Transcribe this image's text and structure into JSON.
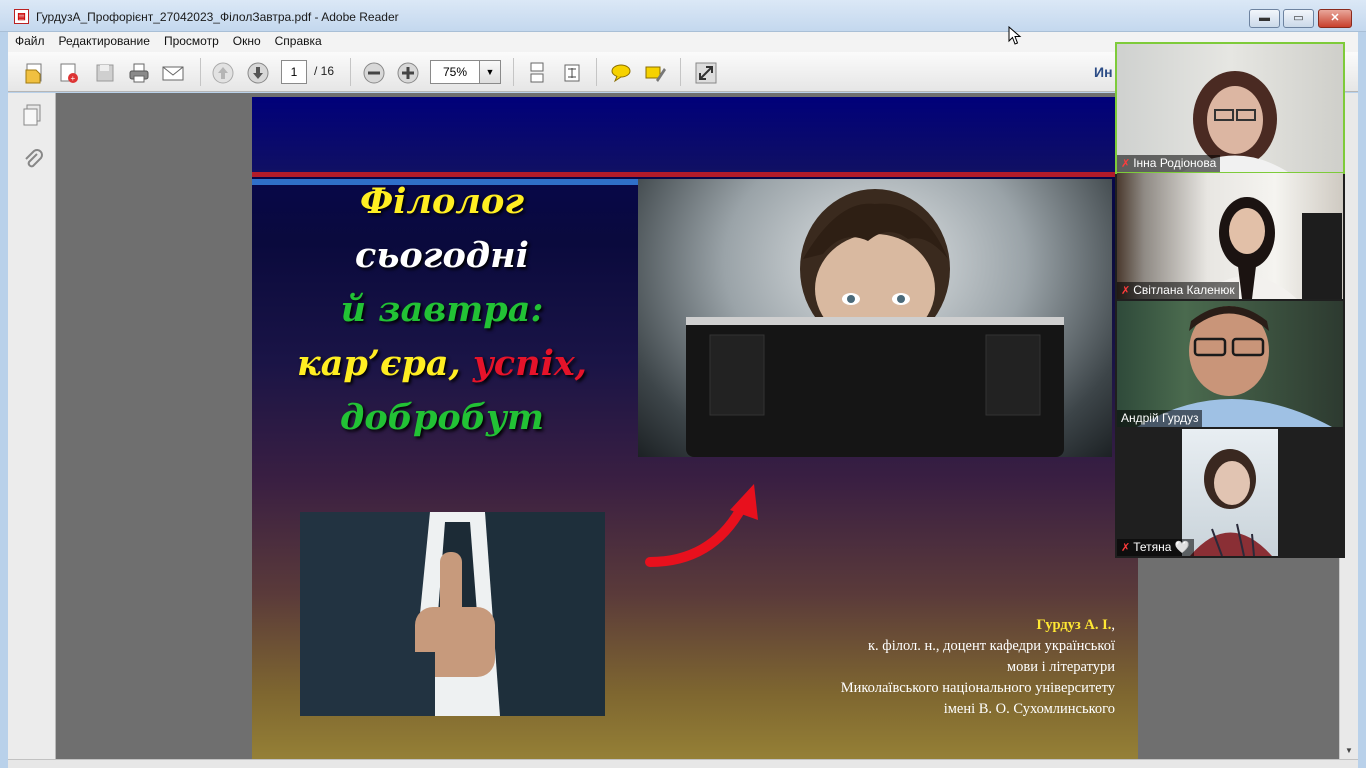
{
  "window": {
    "title": "ГурдузА_Профорієнт_27042023_ФілолЗавтра.pdf - Adobe Reader",
    "icon": "pdf-icon",
    "minimize": "▬",
    "maximize": "▭",
    "close": "✕"
  },
  "menu": {
    "items": [
      "Файл",
      "Редактирование",
      "Просмотр",
      "Окно",
      "Справка"
    ]
  },
  "toolbar": {
    "current_page": "1",
    "total_pages": "/ 16",
    "zoom": "75%",
    "zoom_dropdown": "▼",
    "right_label": "Ин"
  },
  "slide": {
    "headline": {
      "line1": "Філолог",
      "line2": "сьогодні",
      "line3": "й завтра:",
      "line4a": "кар’єра, ",
      "line4b": "успіх,",
      "line5": "добробут"
    },
    "author": {
      "name": "Гурдуз А. І.",
      "name_suffix": ",",
      "line1": "к. філол. н., доцент кафедри української",
      "line2": "мови і літератури",
      "line3": "Миколаївського національного університету",
      "line4": "імені В. О. Сухомлинського"
    },
    "colors": {
      "yellow": "#ffee22",
      "green": "#22c235",
      "red": "#e5132a",
      "arrow": "#e8101d"
    }
  },
  "participants": [
    {
      "name": "Інна Родіонова",
      "muted": true
    },
    {
      "name": "Світлана Каленюк",
      "muted": true
    },
    {
      "name": "Андрій Гурдуз",
      "muted": false
    },
    {
      "name": "Тетяна",
      "muted": true,
      "suffix": "🤍"
    }
  ]
}
